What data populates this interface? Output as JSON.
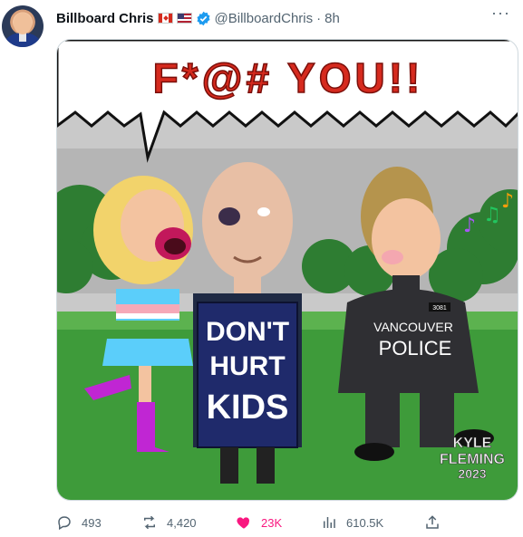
{
  "post": {
    "author_name": "Billboard Chris",
    "handle": "@BillboardChris",
    "separator": "·",
    "time": "8h",
    "more_label": "···"
  },
  "cartoon": {
    "speech": "F*@# YOU!!",
    "sign_lines": [
      "DON'T",
      "HURT",
      "KIDS"
    ],
    "jacket_lines": [
      "VANCOUVER",
      "POLICE"
    ],
    "badge": "3081",
    "signature_lines": [
      "KYLE",
      "FLEMING",
      "2023"
    ]
  },
  "actions": {
    "replies": "493",
    "reposts": "4,420",
    "likes": "23K",
    "views": "610.5K"
  },
  "colors": {
    "verified": "#1d9bf0",
    "like": "#f91880",
    "muted": "#536471"
  },
  "icons": [
    "verified-badge-icon",
    "more-icon",
    "reply-icon",
    "repost-icon",
    "like-icon",
    "views-icon",
    "share-icon"
  ]
}
